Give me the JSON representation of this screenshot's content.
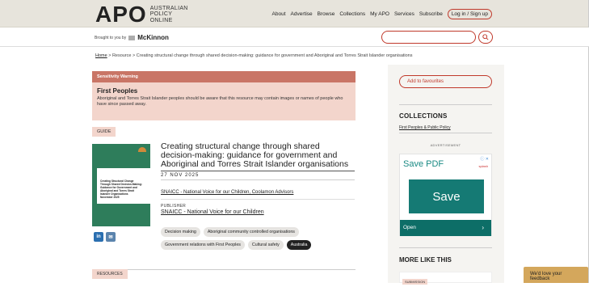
{
  "header": {
    "logo_mark": "APO",
    "logo_sub": [
      "AUSTRALIAN",
      "POLICY",
      "ONLINE"
    ],
    "nav": [
      "About",
      "Advertise",
      "Browse",
      "Collections",
      "My APO",
      "Services",
      "Subscribe"
    ],
    "login_label": "Log in / Sign up"
  },
  "sponsor": {
    "brought_by": "Brought to you by",
    "sponsor_name": "McKinnon"
  },
  "search": {
    "placeholder": ""
  },
  "breadcrumb": {
    "home": "Home",
    "sep": ">",
    "resource": "Resource",
    "current": "Creating structural change through shared decision-making: guidance for government and Aboriginal and Torres Strait Islander organisations"
  },
  "warning": {
    "heading": "Sensitivity Warning",
    "title": "First Peoples",
    "text": "Aboriginal and Torres Strait Islander peoples should be aware that this resource may contain images or names of people who have since passed away."
  },
  "resource": {
    "type": "GUIDE",
    "cover_text": "Creating Structural Change Through Shared Decision-Making: Guidance for Government and Aboriginal and Torres Strait Islander Organisations",
    "cover_date": "November 2025",
    "title": "Creating structural change through shared decision-making: guidance for government and Aboriginal and Torres Strait Islander organisations",
    "date": "27 NOV 2025",
    "authors": "SNAICC - National Voice for our Children, Coolamon Advisors",
    "publisher_label": "PUBLISHER",
    "publisher": "SNAICC - National Voice for our Children",
    "tags": [
      "Decision making",
      "Aboriginal community controlled organisations",
      "Government relations with First Peoples",
      "Cultural safety",
      "Australia"
    ],
    "share": [
      "in",
      "✉"
    ],
    "resources_label": "RESOURCES"
  },
  "sidebar": {
    "favourites": "Add to favourites",
    "collections_heading": "COLLECTIONS",
    "collection_link": "First Peoples & Public Policy",
    "ad_label": "ADVERTISEMENT",
    "ad_title": "Save PDF",
    "ad_brand": "splash",
    "ad_info": "ⓘ ✕",
    "ad_button": "Save",
    "ad_open": "Open",
    "ad_arrow": "›",
    "more_heading": "MORE LIKE THIS",
    "submission_label": "SUBMISSION"
  },
  "feedback": "We'd love your feedback",
  "colors": {
    "accent": "#c0392b",
    "warning_bg": "#f3d5cc",
    "warning_head": "#c97566",
    "ad_teal": "#157a74",
    "feedback_bg": "#d4a75c"
  }
}
